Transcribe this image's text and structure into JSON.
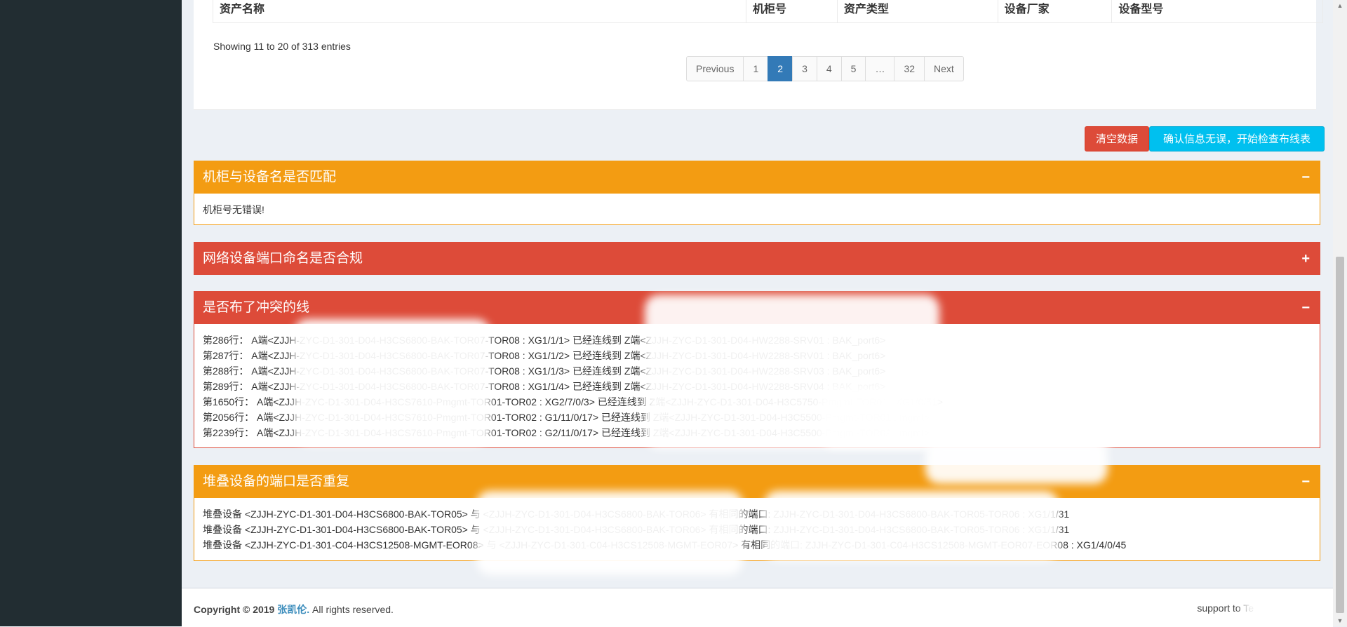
{
  "table": {
    "headers": [
      "资产名称",
      "机柜号",
      "资产类型",
      "设备厂家",
      "设备型号"
    ],
    "entries_info": "Showing 11 to 20 of 313 entries",
    "pagination": [
      "Previous",
      "1",
      "2",
      "3",
      "4",
      "5",
      "…",
      "32",
      "Next"
    ],
    "active_page": "2"
  },
  "actions": {
    "clear_label": "清空数据",
    "confirm_label": "确认信息无误，开始检查布线表"
  },
  "panels": {
    "cabinet": {
      "title": "机柜与设备名是否匹配",
      "toggle": "−",
      "body": "机柜号无错误!"
    },
    "port_naming": {
      "title": "网络设备端口命名是否合规",
      "toggle": "+"
    },
    "conflict": {
      "title": "是否布了冲突的线",
      "toggle": "−",
      "lines": [
        "第286行： A端<ZJJH-ZYC-D1-301-D04-H3CS6800-BAK-TOR07-TOR08 : XG1/1/1> 已经连线到 Z端<ZJJH-ZYC-D1-301-D04-HW2288-SRV01 : BAK_port6>",
        "第287行： A端<ZJJH-ZYC-D1-301-D04-H3CS6800-BAK-TOR07-TOR08 : XG1/1/2> 已经连线到 Z端<ZJJH-ZYC-D1-301-D04-HW2288-SRV01 : BAK_port6>",
        "第288行： A端<ZJJH-ZYC-D1-301-D04-H3CS6800-BAK-TOR07-TOR08 : XG1/1/3> 已经连线到 Z端<ZJJH-ZYC-D1-301-D04-HW2288-SRV03 : BAK_port6>",
        "第289行： A端<ZJJH-ZYC-D1-301-D04-H3CS6800-BAK-TOR07-TOR08 : XG1/1/4> 已经连线到 Z端<ZJJH-ZYC-D1-301-D04-HW2288-SRV04 : BAK_port6>",
        "第1650行： A端<ZJJH-ZYC-D1-301-D04-H3CS7610-Pmgmt-TOR01-TOR02 : XG2/7/0/3> 已经连线到 Z端<ZJJH-ZYC-D1-301-D04-H3C5750-Pmgmt-TOR01 : XG1/0/51>",
        "第2056行： A端<ZJJH-ZYC-D1-301-D04-H3CS7610-Pmgmt-TOR01-TOR02 : G1/11/0/17> 已经连线到 Z端<ZJJH-ZYC-D1-301-D04-H3C5500-Pmgmt-TOR01 : mgmt>",
        "第2239行： A端<ZJJH-ZYC-D1-301-D04-H3CS7610-Pmgmt-TOR01-TOR02 : G2/11/0/17> 已经连线到 Z端<ZJJH-ZYC-D1-301-D04-H3C5500-Pmgmt-TOR02 : mgmt>"
      ]
    },
    "stack": {
      "title": "堆叠设备的端口是否重复",
      "toggle": "−",
      "lines": [
        "堆叠设备 <ZJJH-ZYC-D1-301-D04-H3CS6800-BAK-TOR05> 与 <ZJJH-ZYC-D1-301-D04-H3CS6800-BAK-TOR06> 有相同的端口: ZJJH-ZYC-D1-301-D04-H3CS6800-BAK-TOR05-TOR06 : XG1/1/31",
        "堆叠设备 <ZJJH-ZYC-D1-301-D04-H3CS6800-BAK-TOR05> 与 <ZJJH-ZYC-D1-301-D04-H3CS6800-BAK-TOR06> 有相同的端口: ZJJH-ZYC-D1-301-D04-H3CS6800-BAK-TOR05-TOR06 : XG1/1/31",
        "堆叠设备 <ZJJH-ZYC-D1-301-C04-H3CS12508-MGMT-EOR08> 与 <ZJJH-ZYC-D1-301-C04-H3CS12508-MGMT-EOR07> 有相同的端口: ZJJH-ZYC-D1-301-C04-H3CS12508-MGMT-EOR07-EOR08 : XG1/4/0/45"
      ]
    }
  },
  "footer": {
    "copyright_prefix": "Copyright © 2019",
    "author": "张凯伦.",
    "rights": "All rights reserved.",
    "support": "support to Te"
  }
}
